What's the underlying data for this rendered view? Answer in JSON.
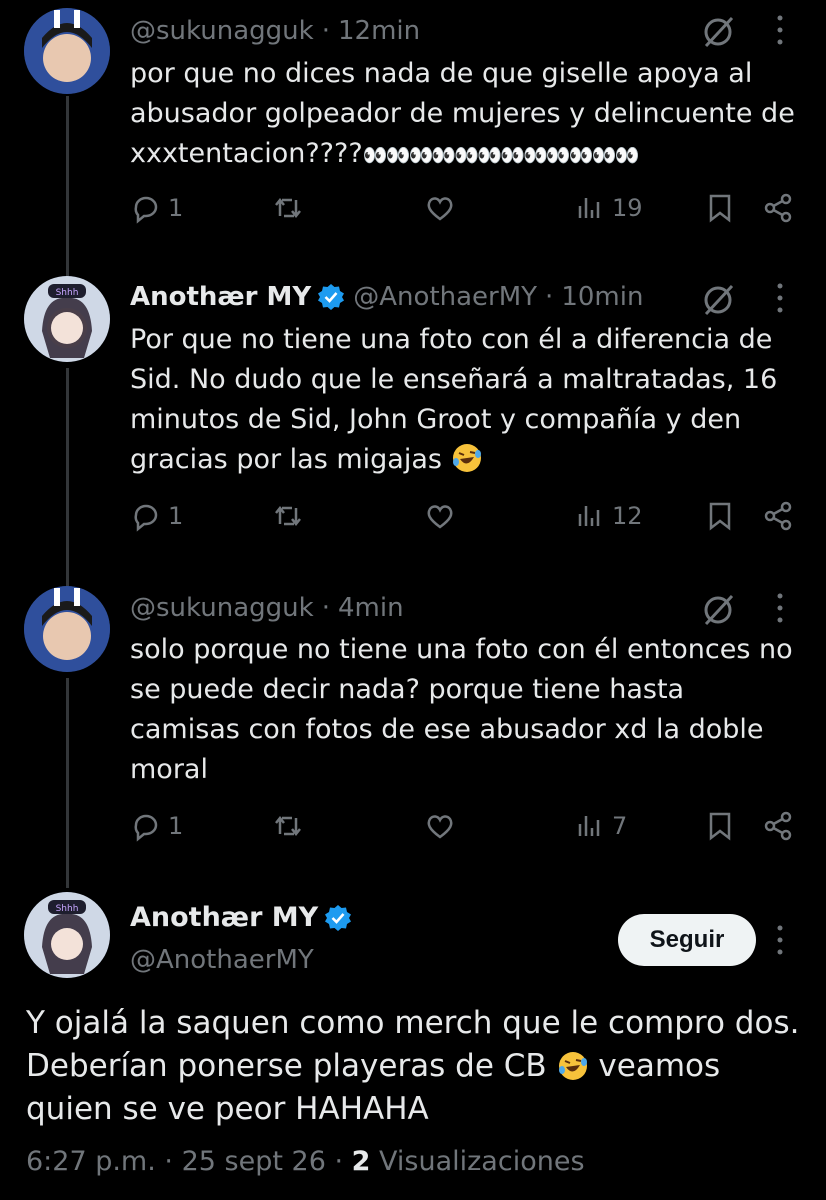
{
  "replies": [
    {
      "handle": "@sukunagguk",
      "sep": "·",
      "time": "12min",
      "text": "por que no dices nada de que giselle apoya al abusador golpeador de mujeres y delincuente de xxxtentacion????",
      "emoji_tail": "👀👀👀👀👀👀👀👀👀👀👀👀",
      "replies_count": "1",
      "views": "19"
    },
    {
      "name": "Anothær MY",
      "handle": "@AnothaerMY",
      "sep": "·",
      "time": "10min",
      "text": "Por que no tiene una foto con él a diferencia de Sid. No dudo que le enseñará a maltratadas, 16 minutos de Sid, John Groot y compañía y den gracias por las migajas",
      "replies_count": "1",
      "views": "12"
    },
    {
      "handle": "@sukunagguk",
      "sep": "·",
      "time": "4min",
      "text": "solo porque no tiene una foto con él entonces no se puede decir nada? porque tiene hasta camisas con fotos de ese abusador xd la doble moral",
      "replies_count": "1",
      "views": "7"
    }
  ],
  "main": {
    "name": "Anothær MY",
    "handle": "@AnothaerMY",
    "follow_label": "Seguir",
    "text_part1": "Y ojalá la saquen como merch que le compro dos. Deberían ponerse playeras de CB",
    "text_part2": "veamos quien se ve peor HAHAHA",
    "time": "6:27 p.m.",
    "date": "25 sept 26",
    "views_count": "2",
    "views_label": "Visualizaciones"
  },
  "colors": {
    "accent": "#1d9bf0",
    "muted": "#71767b",
    "text": "#e7e9ea",
    "bg": "#000000"
  },
  "icons": [
    "reply-icon",
    "repost-icon",
    "like-icon",
    "views-icon",
    "bookmark-icon",
    "share-icon",
    "grok-icon",
    "more-icon",
    "verified-icon"
  ]
}
